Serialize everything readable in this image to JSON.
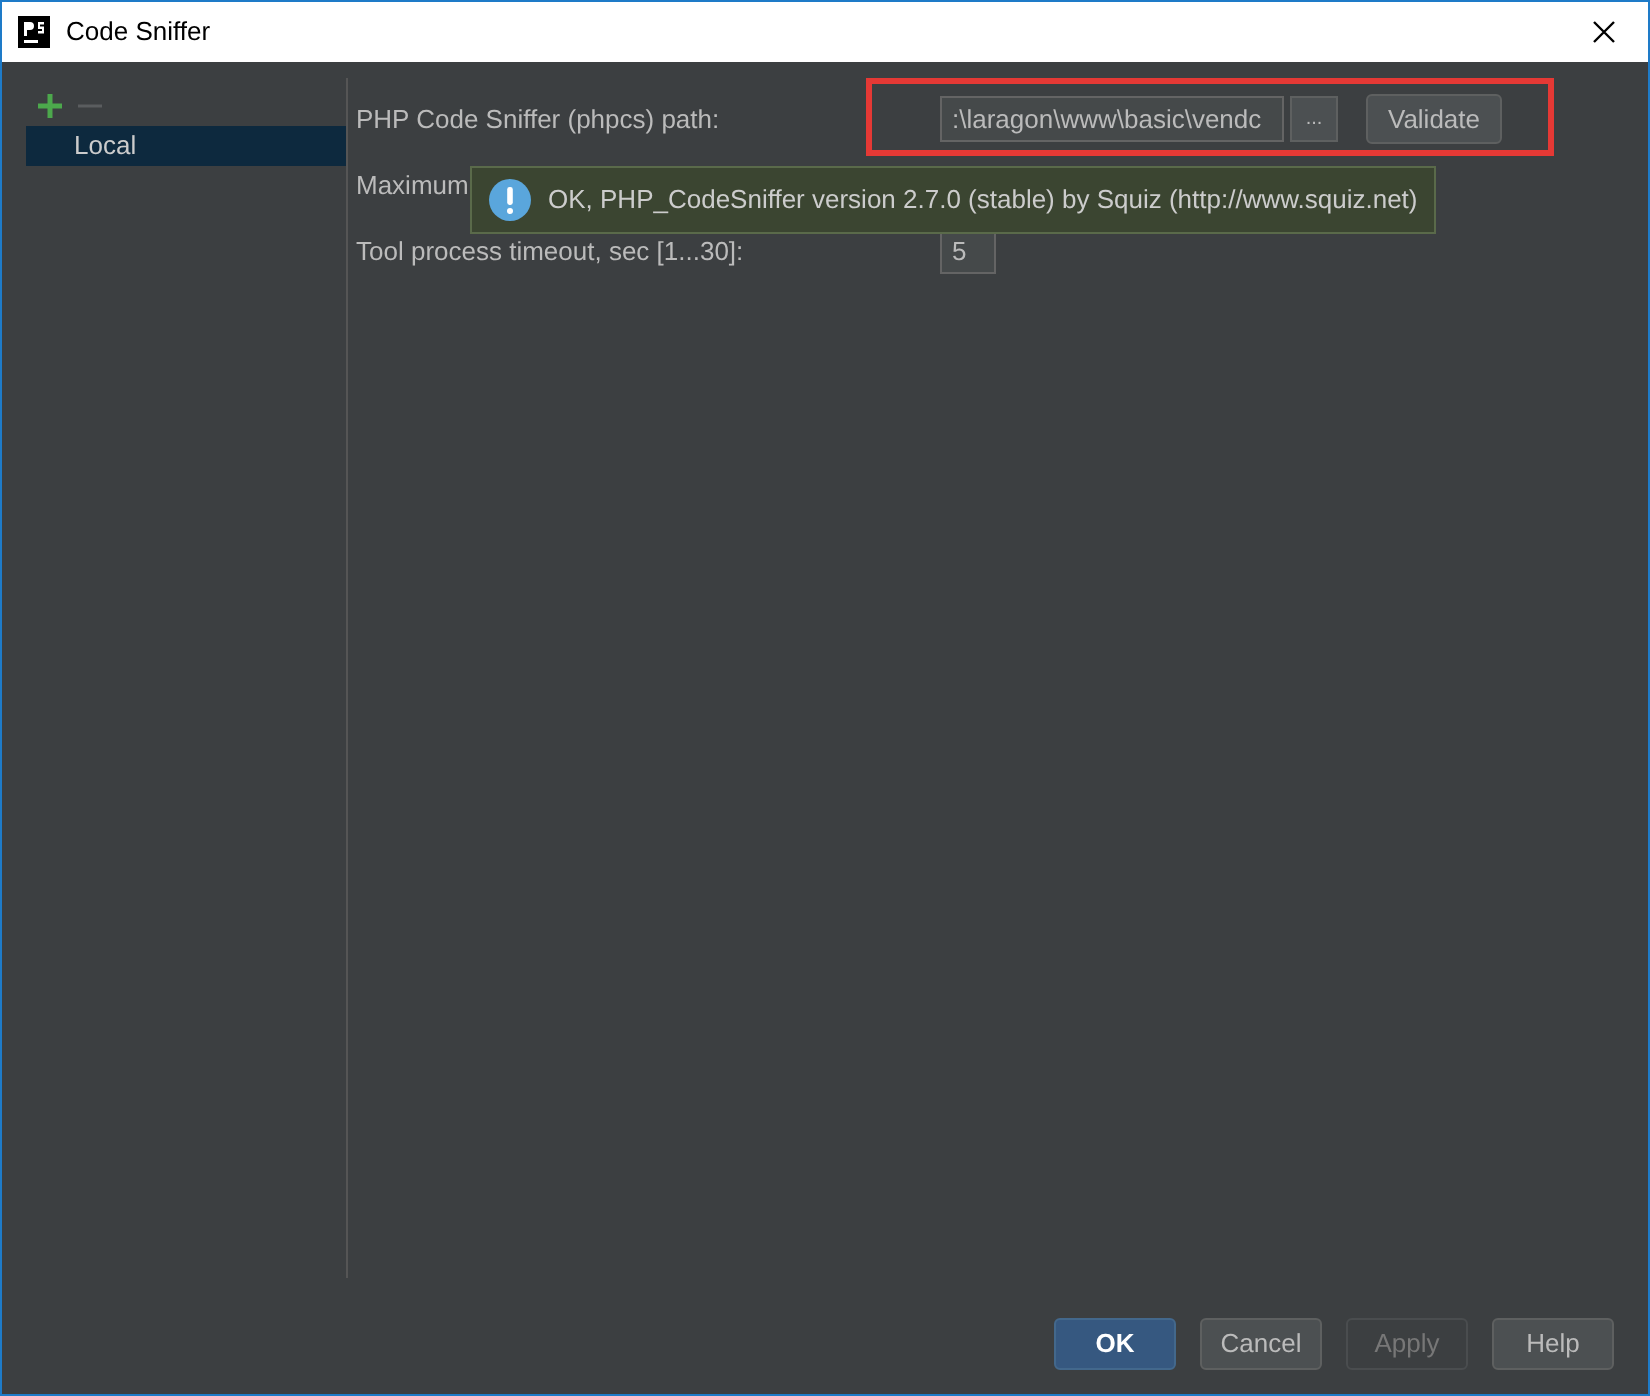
{
  "window": {
    "title": "Code Sniffer"
  },
  "sidebar": {
    "items": [
      {
        "label": "Local",
        "selected": true
      }
    ]
  },
  "settings": [
    {
      "kind": "path",
      "label": "PHP Code Sniffer (phpcs) path:",
      "value": ":\\laragon\\www\\basic\\vendc",
      "browse": "...",
      "action": "Validate"
    },
    {
      "kind": "label",
      "label": "Maximum"
    },
    {
      "kind": "number",
      "label": "Tool process timeout, sec [1...30]:",
      "value": "5"
    }
  ],
  "tooltip": {
    "text": "OK, PHP_CodeSniffer version 2.7.0 (stable) by Squiz (http://www.squiz.net)"
  },
  "buttons": [
    {
      "label": "OK",
      "kind": "default",
      "disabled": false
    },
    {
      "label": "Cancel",
      "kind": "normal",
      "disabled": false
    },
    {
      "label": "Apply",
      "kind": "normal",
      "disabled": true
    },
    {
      "label": "Help",
      "kind": "normal",
      "disabled": false
    }
  ]
}
